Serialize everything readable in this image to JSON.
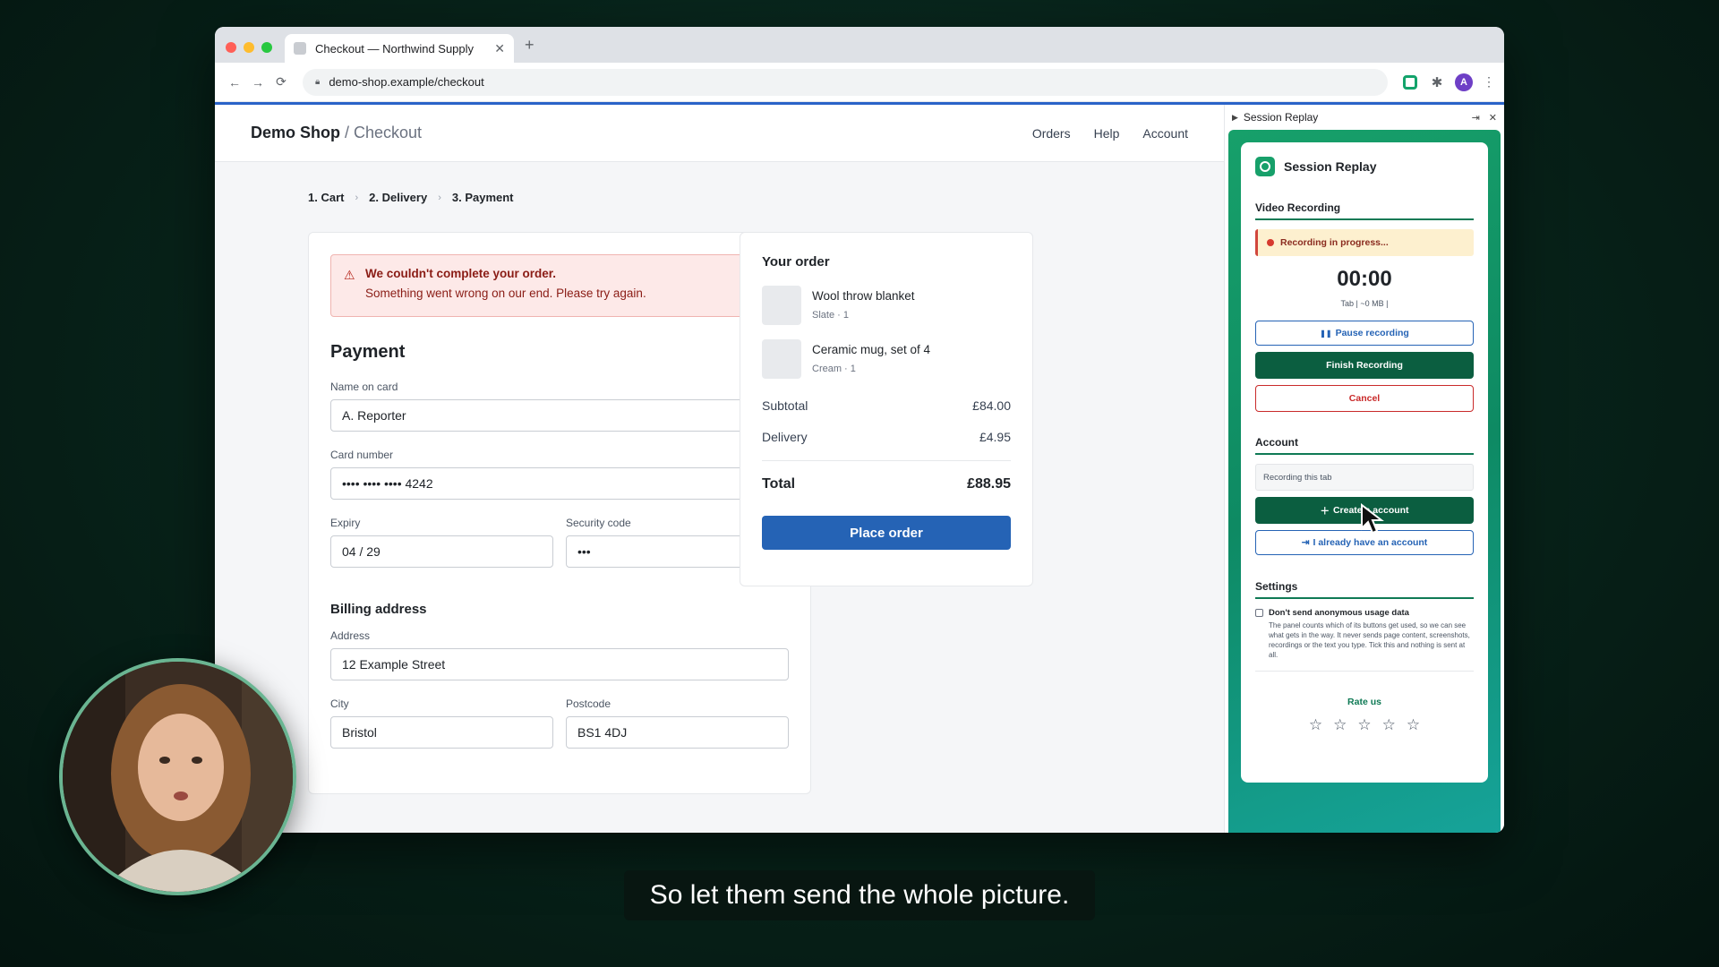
{
  "browser": {
    "tab_title": "Checkout — Northwind Supply",
    "tab_close": "✕",
    "new_tab": "+",
    "url": "demo-shop.example/checkout",
    "back": "←",
    "forward": "→",
    "reload": "⟳",
    "profile_initial": "A",
    "menu": "⋮"
  },
  "site": {
    "brand": "Demo Shop",
    "crumb": " / Checkout",
    "nav": [
      "Orders",
      "Help",
      "Account"
    ]
  },
  "steps": [
    "1. Cart",
    "2. Delivery",
    "3. Payment"
  ],
  "alert": {
    "title": "We couldn't complete your order.",
    "body": "Something went wrong on our end. Please try again."
  },
  "payment": {
    "heading": "Payment",
    "name_label": "Name on card",
    "name_value": "A. Reporter",
    "card_label": "Card number",
    "card_value": "•••• •••• •••• 4242",
    "expiry_label": "Expiry",
    "expiry_value": "04 / 29",
    "cvc_label": "Security code",
    "cvc_value": "•••"
  },
  "billing": {
    "heading": "Billing address",
    "address_label": "Address",
    "address_value": "12 Example Street",
    "city_label": "City",
    "city_value": "Bristol",
    "postcode_label": "Postcode",
    "postcode_value": "BS1 4DJ"
  },
  "order": {
    "title": "Your order",
    "items": [
      {
        "name": "Wool throw blanket",
        "sub": "Slate · 1"
      },
      {
        "name": "Ceramic mug, set of 4",
        "sub": "Cream · 1"
      }
    ],
    "subtotal_label": "Subtotal",
    "subtotal_value": "£84.00",
    "delivery_label": "Delivery",
    "delivery_value": "£4.95",
    "total_label": "Total",
    "total_value": "£88.95",
    "place_order": "Place order"
  },
  "side_panel": {
    "header": "Session Replay",
    "title": "Session Replay",
    "video_section": "Video Recording",
    "recording_status": "Recording in progress...",
    "timer": "00:00",
    "timer_sub": "Tab | ~0 MB |",
    "pause": "Pause recording",
    "finish": "Finish Recording",
    "cancel": "Cancel",
    "account_section": "Account",
    "account_field": "Recording this tab",
    "create_account": "Create a     account",
    "have_account": "I already have an account",
    "settings_section": "Settings",
    "setting_title": "Don't send anonymous usage data",
    "setting_desc": "The panel counts which of its buttons get used, so we can see what gets in the way. It never sends page content, screenshots, recordings or the text you type. Tick this and nothing is sent at all.",
    "rate_us": "Rate us",
    "stars": [
      "☆",
      "☆",
      "☆",
      "☆",
      "☆"
    ]
  },
  "caption": "So let them send the whole picture.",
  "colors": {
    "accent_blue": "#2563b5",
    "accent_green": "#0b5e40",
    "error_red": "#c92a2a"
  }
}
